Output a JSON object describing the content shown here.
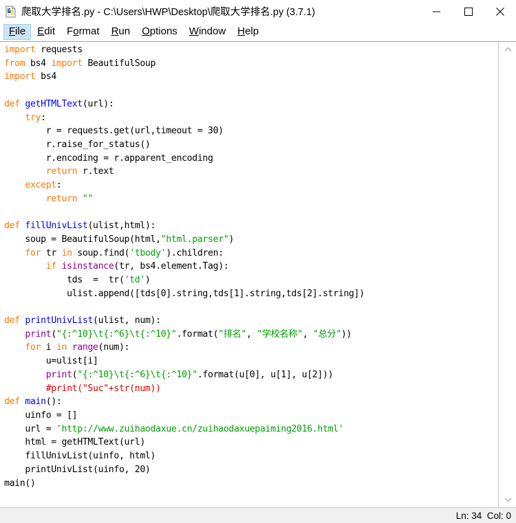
{
  "window": {
    "title": "爬取大学排名.py - C:\\Users\\HWP\\Desktop\\爬取大学排名.py (3.7.1)",
    "app_icon": "python-file-icon",
    "controls": {
      "minimize_label": "—",
      "maximize_label": "☐",
      "close_label": "✕"
    }
  },
  "menubar": {
    "items": [
      {
        "label": "File",
        "mnemonic": "F",
        "rest": "ile",
        "active": true
      },
      {
        "label": "Edit",
        "mnemonic": "E",
        "rest": "dit",
        "active": false
      },
      {
        "label": "Format",
        "mnemonic": "o",
        "rest": "rmat",
        "pre": "F",
        "active": false
      },
      {
        "label": "Run",
        "mnemonic": "R",
        "rest": "un",
        "active": false
      },
      {
        "label": "Options",
        "mnemonic": "O",
        "rest": "ptions",
        "active": false
      },
      {
        "label": "Window",
        "mnemonic": "W",
        "rest": "indow",
        "active": false
      },
      {
        "label": "Help",
        "mnemonic": "H",
        "rest": "elp",
        "active": false
      }
    ]
  },
  "editor": {
    "language": "python",
    "filename": "爬取大学排名.py",
    "code_lines": [
      "import requests",
      "from bs4 import BeautifulSoup",
      "import bs4",
      "",
      "def getHTMLText(url):",
      "    try:",
      "        r = requests.get(url,timeout = 30)",
      "        r.raise_for_status()",
      "        r.encoding = r.apparent_encoding",
      "        return r.text",
      "    except:",
      "        return \"\"",
      "",
      "def fillUnivList(ulist,html):",
      "    soup = BeautifulSoup(html,\"html.parser\")",
      "    for tr in soup.find('tbody').children:",
      "        if isinstance(tr, bs4.element.Tag):",
      "            tds  =  tr('td')",
      "            ulist.append([tds[0].string,tds[1].string,tds[2].string])",
      "",
      "def printUnivList(ulist, num):",
      "    print(\"{:^10}\\t{:^6}\\t{:^10}\".format(\"排名\", \"学校名称\", \"总分\"))",
      "    for i in range(num):",
      "        u=ulist[i]",
      "        print(\"{:^10}\\t{:^6}\\t{:^10}\".format(u[0], u[1], u[2]))",
      "        #print(\"Suc\"+str(num))",
      "def main():",
      "    uinfo = []",
      "    url = 'http://www.zuihaodaxue.cn/zuihaodaxuepaiming2016.html'",
      "    html = getHTMLText(url)",
      "    fillUnivList(uinfo, html)",
      "    printUnivList(uinfo, 20)",
      "main()"
    ],
    "syntax_colors": {
      "keyword": "#ff7700",
      "definition": "#0000ff",
      "string": "#00a000",
      "builtin": "#900090",
      "comment": "#dd0000",
      "normal": "#000000"
    }
  },
  "scrollbar": {
    "up_arrow": "chevron-up-icon",
    "down_arrow": "chevron-down-icon"
  },
  "statusbar": {
    "position": "Ln: 34  Col: 0"
  }
}
